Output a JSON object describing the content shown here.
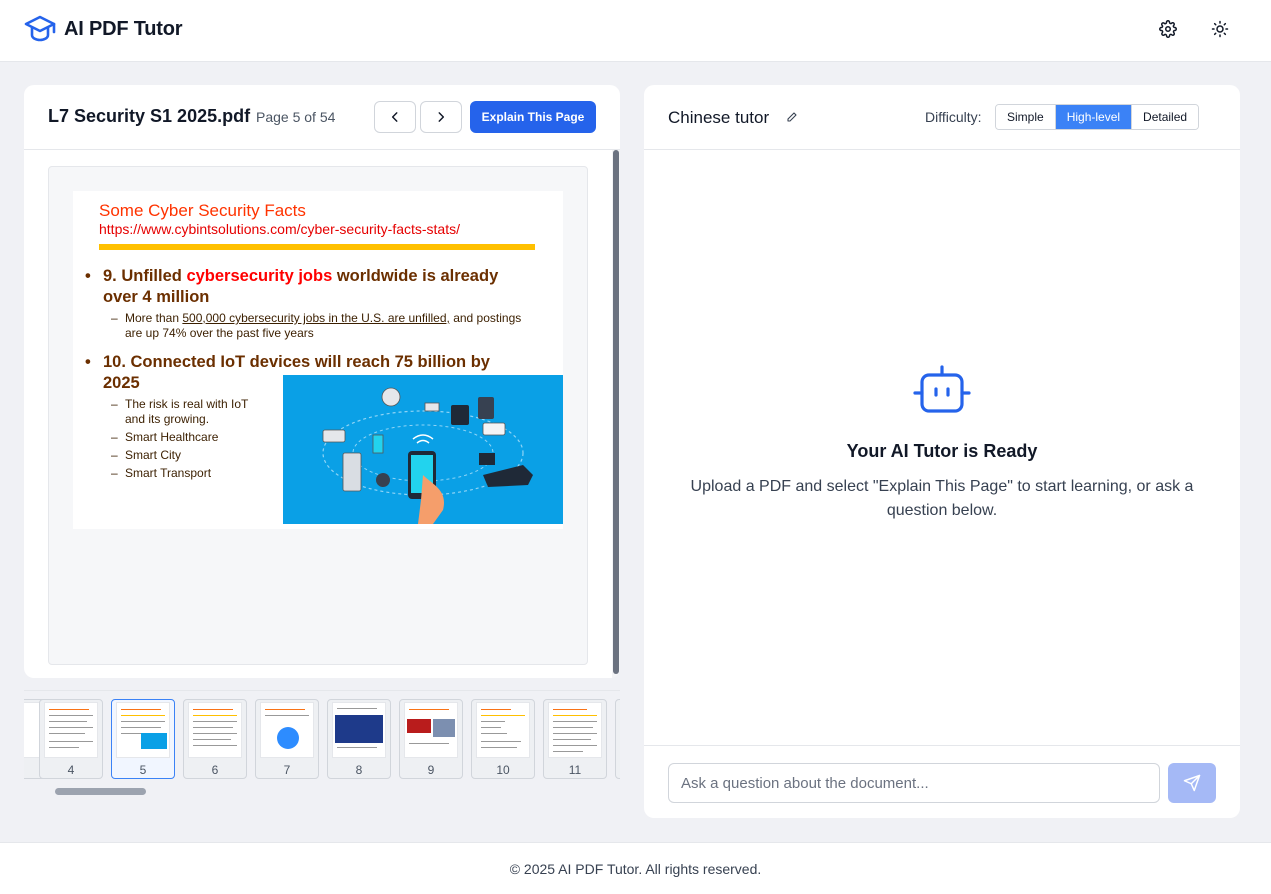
{
  "app": {
    "name": "AI PDF Tutor",
    "logo_icon": "graduation-cap-icon",
    "settings_icon": "gear-icon",
    "theme_icon": "sun-icon",
    "accent_color": "#2563eb"
  },
  "viewer": {
    "doc_title": "L7 Security S1 2025.pdf",
    "page_indicator": "Page 5 of 54",
    "prev_icon": "chevron-left-icon",
    "next_icon": "chevron-right-icon",
    "explain_label": "Explain This Page",
    "slide": {
      "title": "Some Cyber Security Facts",
      "url": "https://www.cybintsolutions.com/cyber-security-facts-stats/",
      "bullet1_pre": "9. Unfilled ",
      "bullet1_red": "cybersecurity jobs",
      "bullet1_post": " worldwide is already over 4 million",
      "sub1_pre": "More than ",
      "sub1_underline": "500,000 cybersecurity jobs in the U.S. are unfilled,",
      "sub1_post": " and postings are up 74% over the past five years",
      "bullet2": "10. Connected IoT devices will reach 75 billion by 2025",
      "sub2": [
        "The risk is real with IoT and its growing.",
        "Smart Healthcare",
        "Smart City",
        "Smart Transport"
      ]
    }
  },
  "thumbnails": [
    {
      "page": "4"
    },
    {
      "page": "5"
    },
    {
      "page": "6"
    },
    {
      "page": "7"
    },
    {
      "page": "8"
    },
    {
      "page": "9"
    },
    {
      "page": "10"
    },
    {
      "page": "11"
    }
  ],
  "tutor": {
    "name": "Chinese tutor",
    "edit_icon": "pencil-icon",
    "difficulty_label": "Difficulty:",
    "difficulty_options": [
      "Simple",
      "High-level",
      "Detailed"
    ],
    "difficulty_selected": "High-level",
    "ready_icon": "robot-icon",
    "ready_title": "Your AI Tutor is Ready",
    "ready_desc": "Upload a PDF and select \"Explain This Page\" to start learning, or ask a question below.",
    "input_placeholder": "Ask a question about the document...",
    "send_icon": "send-icon"
  },
  "footer": {
    "text": "© 2025 AI PDF Tutor. All rights reserved."
  }
}
